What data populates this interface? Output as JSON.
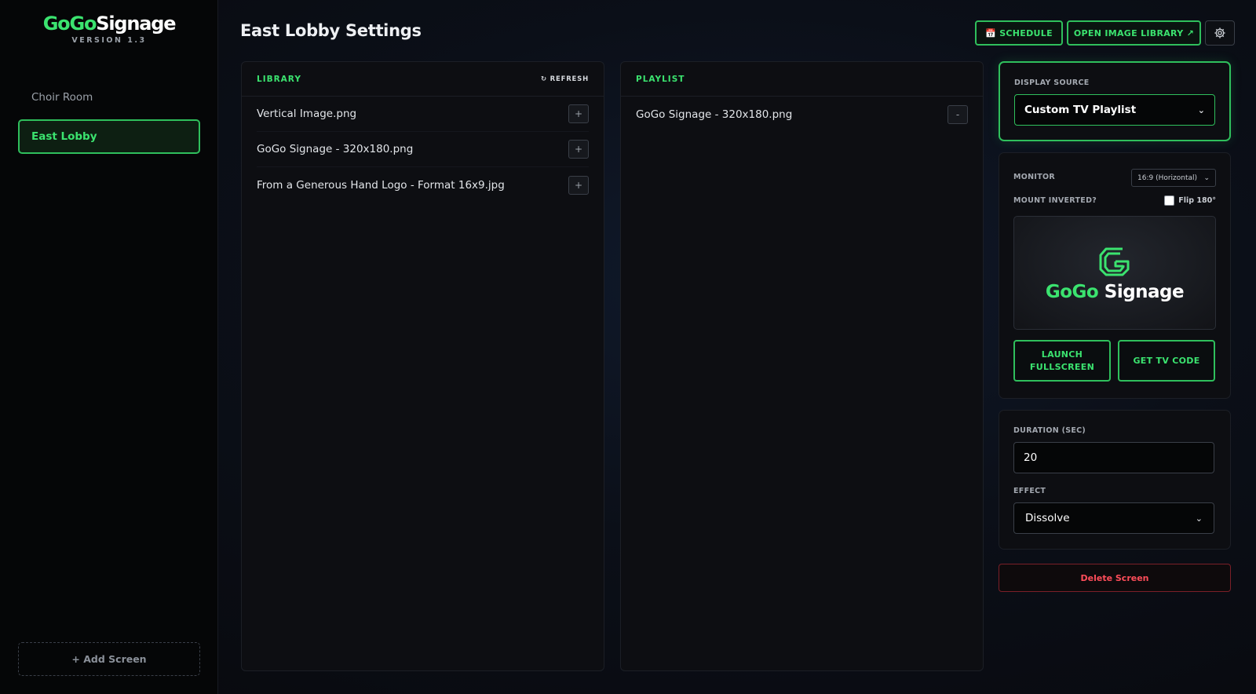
{
  "brand": {
    "name_part1": "GoGo",
    "name_part2": "Signage",
    "version": "VERSION 1.3"
  },
  "sidebar": {
    "screens": [
      {
        "label": "Choir Room",
        "active": false
      },
      {
        "label": "East Lobby",
        "active": true
      }
    ],
    "add_screen_label": "+ Add Screen"
  },
  "header": {
    "title": "East Lobby Settings",
    "schedule_label": "📅 SCHEDULE",
    "library_label": "OPEN IMAGE LIBRARY ↗",
    "settings_icon": "gear-icon"
  },
  "library": {
    "label": "LIBRARY",
    "refresh_label": "↻ REFRESH",
    "items": [
      {
        "name": "Vertical Image.png",
        "action": "+"
      },
      {
        "name": "GoGo Signage - 320x180.png",
        "action": "+"
      },
      {
        "name": "From a Generous Hand Logo - Format 16x9.jpg",
        "action": "+"
      }
    ]
  },
  "playlist": {
    "label": "PLAYLIST",
    "items": [
      {
        "name": "GoGo Signage - 320x180.png",
        "action": "-"
      }
    ]
  },
  "display_source": {
    "label": "DISPLAY SOURCE",
    "value": "Custom TV Playlist"
  },
  "monitor": {
    "label": "MONITOR",
    "orientation": "16:9 (Horizontal)",
    "mount_label": "MOUNT INVERTED?",
    "flip_label": "Flip 180°",
    "flip_checked": false,
    "preview_text_part1": "GoGo",
    "preview_text_part2": "Signage",
    "launch_line1": "LAUNCH",
    "launch_line2": "FULLSCREEN",
    "tv_code_label": "GET TV CODE"
  },
  "timing": {
    "duration_label": "DURATION (SEC)",
    "duration_value": "20",
    "effect_label": "EFFECT",
    "effect_value": "Dissolve"
  },
  "delete_label": "Delete Screen",
  "colors": {
    "accent": "#3be36f",
    "accent_border": "#2fbf5c",
    "danger": "#ff4d5a",
    "bg": "#0a0c12"
  }
}
